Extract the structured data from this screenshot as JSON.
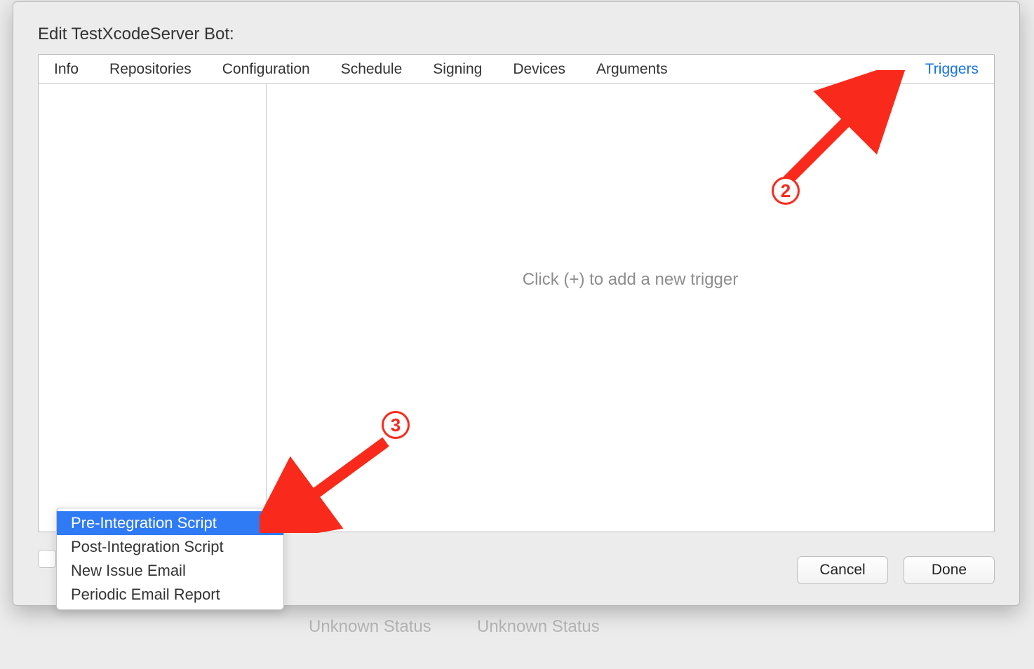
{
  "dialog": {
    "title": "Edit TestXcodeServer Bot:"
  },
  "tabs": {
    "info": "Info",
    "repositories": "Repositories",
    "configuration": "Configuration",
    "schedule": "Schedule",
    "signing": "Signing",
    "devices": "Devices",
    "arguments": "Arguments",
    "triggers": "Triggers",
    "active_index": 7
  },
  "main": {
    "placeholder": "Click (+) to add a new trigger"
  },
  "menu": {
    "items": [
      "Pre-Integration Script",
      "Post-Integration Script",
      "New Issue Email",
      "Periodic Email Report"
    ],
    "selected_index": 0
  },
  "buttons": {
    "cancel": "Cancel",
    "done": "Done"
  },
  "annotations": {
    "two": "2",
    "three": "3"
  },
  "background": {
    "unknown1": "Unknown Status",
    "unknown2": "Unknown Status"
  }
}
